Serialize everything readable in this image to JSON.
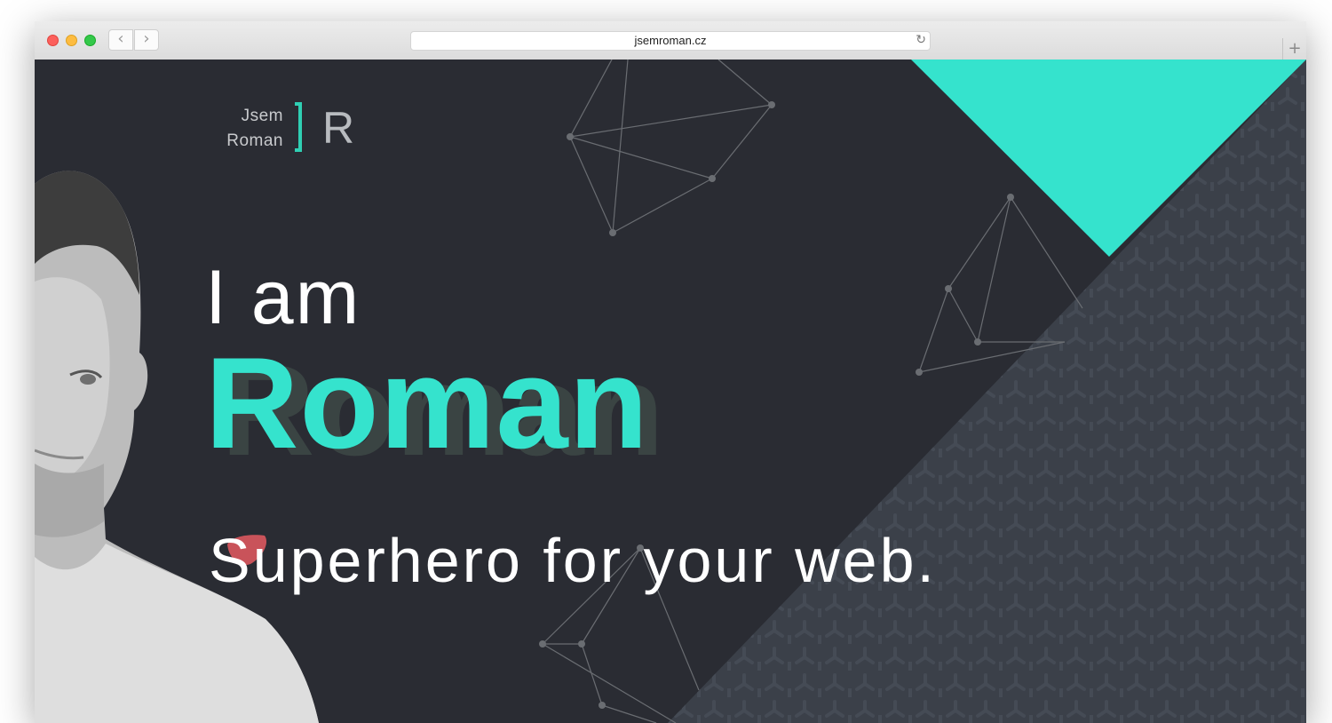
{
  "browser": {
    "url": "jsemroman.cz",
    "back_glyph": "‹",
    "forward_glyph": "›",
    "reload_glyph": "↻",
    "new_tab_glyph": "+"
  },
  "logo": {
    "line1": "Jsem",
    "line2": "Roman",
    "letter": "R"
  },
  "hero": {
    "intro": "I am",
    "name": "Roman",
    "tagline": "Superhero for your web."
  },
  "colors": {
    "accent": "#35e3cd",
    "background": "#2a2c33",
    "pattern": "#3b4049",
    "blob": "#c9535a"
  }
}
